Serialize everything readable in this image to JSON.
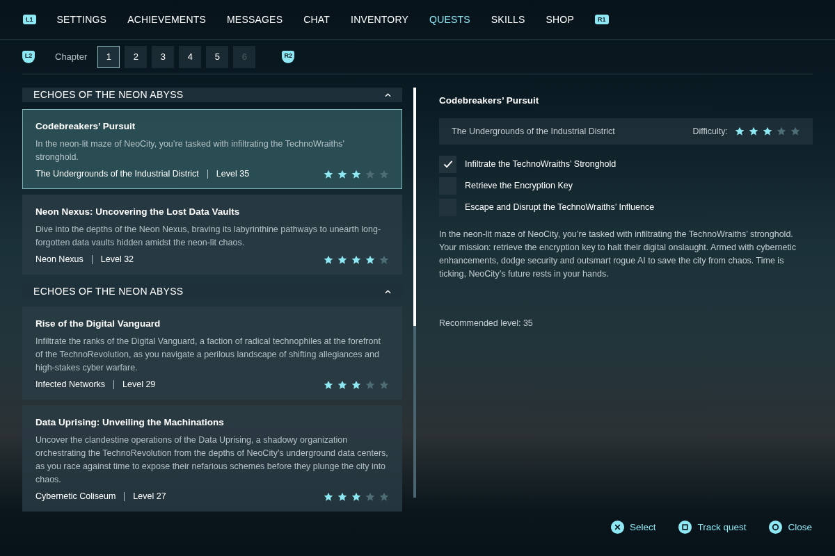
{
  "nav": {
    "left_button": "L1",
    "right_button": "R1",
    "tabs": [
      {
        "label": "SETTINGS",
        "selected": false
      },
      {
        "label": "ACHIEVEMENTS",
        "selected": false
      },
      {
        "label": "MESSAGES",
        "selected": false
      },
      {
        "label": "CHAT",
        "selected": false
      },
      {
        "label": "INVENTORY",
        "selected": false
      },
      {
        "label": "QUESTS",
        "selected": true
      },
      {
        "label": "SKILLS",
        "selected": false
      },
      {
        "label": "SHOP",
        "selected": false
      }
    ]
  },
  "chapters": {
    "left_button": "L2",
    "right_button": "R2",
    "label": "Chapter",
    "items": [
      {
        "label": "1",
        "selected": true,
        "disabled": false
      },
      {
        "label": "2",
        "selected": false,
        "disabled": false
      },
      {
        "label": "3",
        "selected": false,
        "disabled": false
      },
      {
        "label": "4",
        "selected": false,
        "disabled": false
      },
      {
        "label": "5",
        "selected": false,
        "disabled": false
      },
      {
        "label": "6",
        "selected": false,
        "disabled": true
      }
    ]
  },
  "groups": [
    {
      "title": "ECHOES OF THE NEON ABYSS",
      "expanded": true,
      "quests": [
        {
          "title": "Codebreakers’ Pursuit",
          "description": "In the neon-lit maze of NeoCity, you’re tasked with infiltrating the TechnoWraiths’ stronghold.",
          "location": "The Undergrounds of the Industrial District",
          "level": "Level 35",
          "stars": 3,
          "selected": true
        },
        {
          "title": "Neon Nexus: Uncovering the Lost Data Vaults",
          "description": "Dive into the depths of the Neon Nexus, braving its labyrinthine pathways to unearth long-forgotten data vaults hidden amidst the neon-lit chaos.",
          "location": "Neon Nexus",
          "level": "Level 32",
          "stars": 4,
          "selected": false
        }
      ]
    },
    {
      "title": "ECHOES OF THE NEON ABYSS",
      "expanded": true,
      "quests": [
        {
          "title": "Rise of the Digital Vanguard",
          "description": "Infiltrate the ranks of the Digital Vanguard, a faction of radical technophiles at the forefront of the TechnoRevolution, as you navigate a perilous landscape of shifting allegiances and high-stakes cyber warfare.",
          "location": "Infected Networks",
          "level": "Level 29",
          "stars": 3,
          "selected": false
        },
        {
          "title": "Data Uprising: Unveiling the Machinations",
          "description": "Uncover the clandestine operations of the Data Uprising, a shadowy organization orchestrating the TechnoRevolution from the depths of NeoCity’s underground data centers, as you race against time to expose their nefarious schemes before they plunge the city into chaos.",
          "location": "Cybernetic Coliseum",
          "level": "Level 27",
          "stars": 3,
          "selected": false
        }
      ]
    }
  ],
  "detail": {
    "title": "Codebreakers’ Pursuit",
    "location": "The Undergrounds of the Industrial District",
    "difficulty_label": "Difficulty:",
    "stars": 3,
    "objectives": [
      {
        "label": "Infiltrate the TechnoWraiths’ Stronghold",
        "checked": true
      },
      {
        "label": "Retrieve the Encryption Key",
        "checked": false
      },
      {
        "label": "Escape and Disrupt the TechnoWraiths’ Influence",
        "checked": false
      }
    ],
    "description": "In the neon-lit maze of NeoCity, you’re tasked with infiltrating the TechnoWraiths’ stronghold. Your mission: retrieve the encryption key to halt their digital onslaught. Armed with cybernetic enhancements, dodge security and outsmart rogue AI to save the city from chaos. Time is ticking, NeoCity’s future rests in your hands.",
    "recommended": "Recommended level: 35"
  },
  "hints": [
    {
      "kind": "cross",
      "label": "Select"
    },
    {
      "kind": "square",
      "label": "Track quest"
    },
    {
      "kind": "circle",
      "label": "Close"
    }
  ]
}
